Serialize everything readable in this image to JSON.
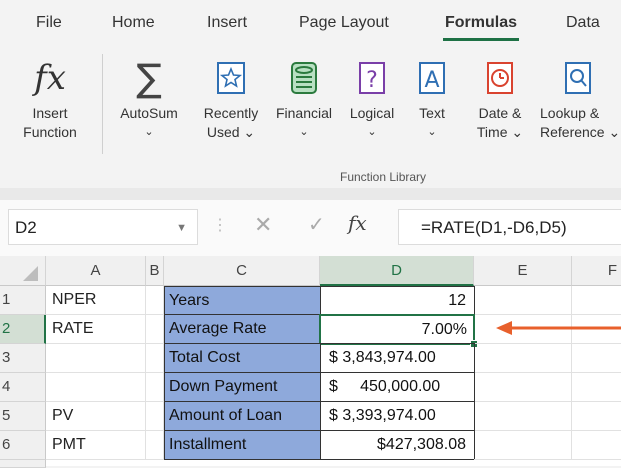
{
  "ribbon_tabs": [
    "File",
    "Home",
    "Insert",
    "Page Layout",
    "Formulas",
    "Data"
  ],
  "active_tab": "Formulas",
  "ribbon_buttons": {
    "insert_function": [
      "Insert",
      "Function"
    ],
    "autosum": [
      "AutoSum",
      "⌄"
    ],
    "recently_used": [
      "Recently",
      "Used ⌄"
    ],
    "financial": [
      "Financial",
      "⌄"
    ],
    "logical": [
      "Logical",
      "⌄"
    ],
    "text": [
      "Text",
      "⌄"
    ],
    "date_time": [
      "Date &",
      "Time ⌄"
    ],
    "lookup": [
      "Lookup &",
      "Reference ⌄"
    ]
  },
  "group_label": "Function Library",
  "name_box": "D2",
  "formula": "=RATE(D1,-D6,D5)",
  "columns": [
    "A",
    "B",
    "C",
    "D",
    "E",
    "F"
  ],
  "rows": [
    {
      "num": "1",
      "a": "NPER",
      "c": "Years",
      "d": "12"
    },
    {
      "num": "2",
      "a": "RATE",
      "c": "Average Rate",
      "d": "7.00%"
    },
    {
      "num": "3",
      "a": "",
      "c": "Total Cost",
      "d": "$ 3,843,974.00"
    },
    {
      "num": "4",
      "a": "",
      "c": "Down Payment",
      "d": "$     450,000.00"
    },
    {
      "num": "5",
      "a": "PV",
      "c": "Amount of Loan",
      "d": "$ 3,393,974.00"
    },
    {
      "num": "6",
      "a": "PMT",
      "c": "Installment",
      "d": "$427,308.08"
    }
  ],
  "colors": {
    "accent": "#217346",
    "table_fill": "#8ea9db",
    "arrow": "#e8602c"
  }
}
